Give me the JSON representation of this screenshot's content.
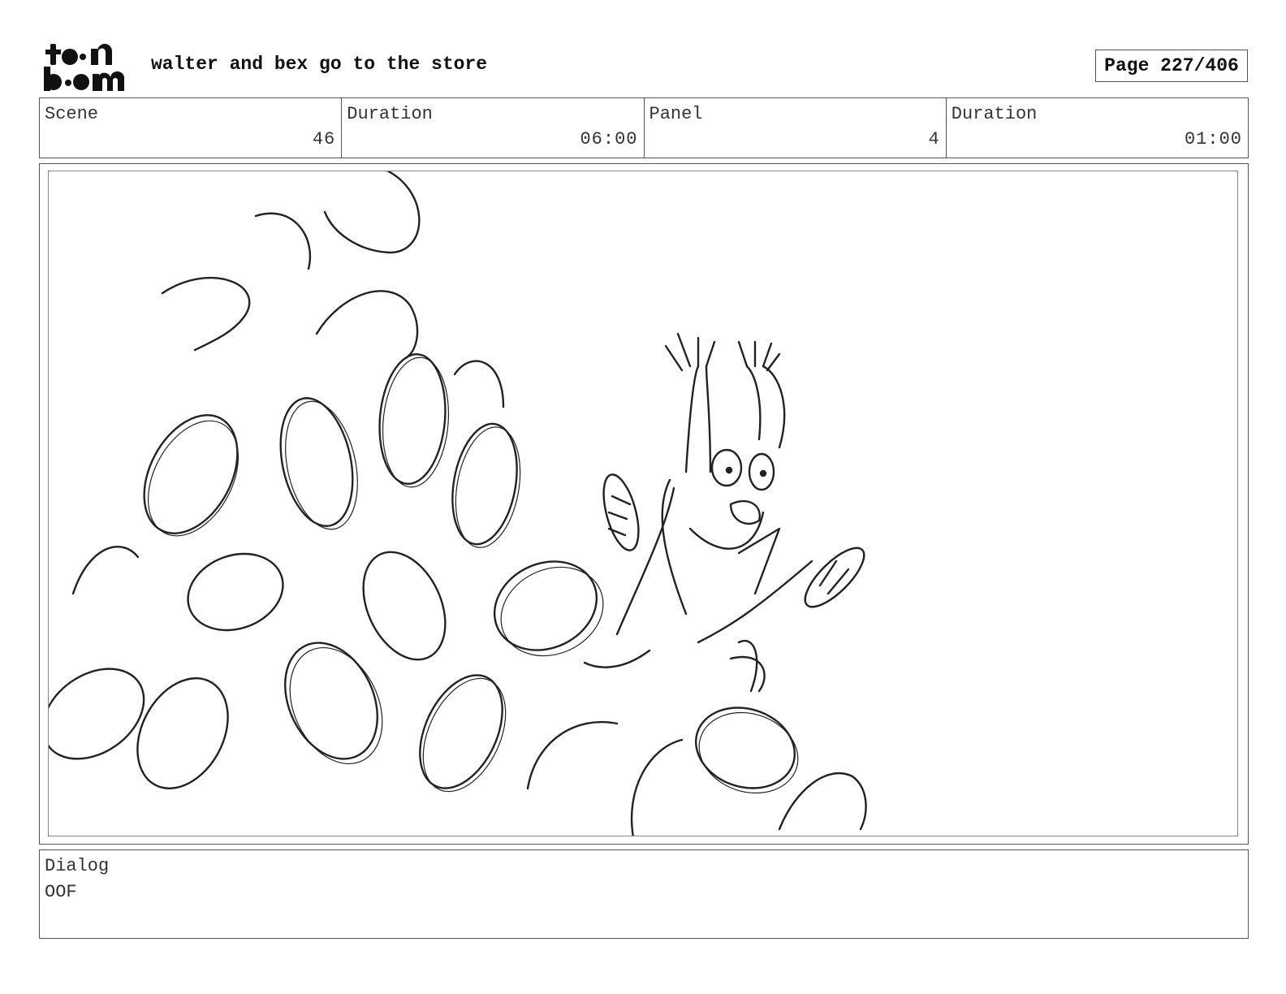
{
  "logo": {
    "line1": "t●●n",
    "line2": "b●●m",
    "icon": "toon-boom-logo"
  },
  "header": {
    "project_title": "walter and bex go to the store",
    "page_label": "Page 227/406"
  },
  "info": [
    {
      "label": "Scene",
      "value": "46"
    },
    {
      "label": "Duration",
      "value": "06:00"
    },
    {
      "label": "Panel",
      "value": "4"
    },
    {
      "label": "Duration",
      "value": "01:00"
    }
  ],
  "panel": {
    "image": "pencil-sketch-character-buried-in-coins"
  },
  "dialog": {
    "label": "Dialog",
    "text": "OOF"
  }
}
